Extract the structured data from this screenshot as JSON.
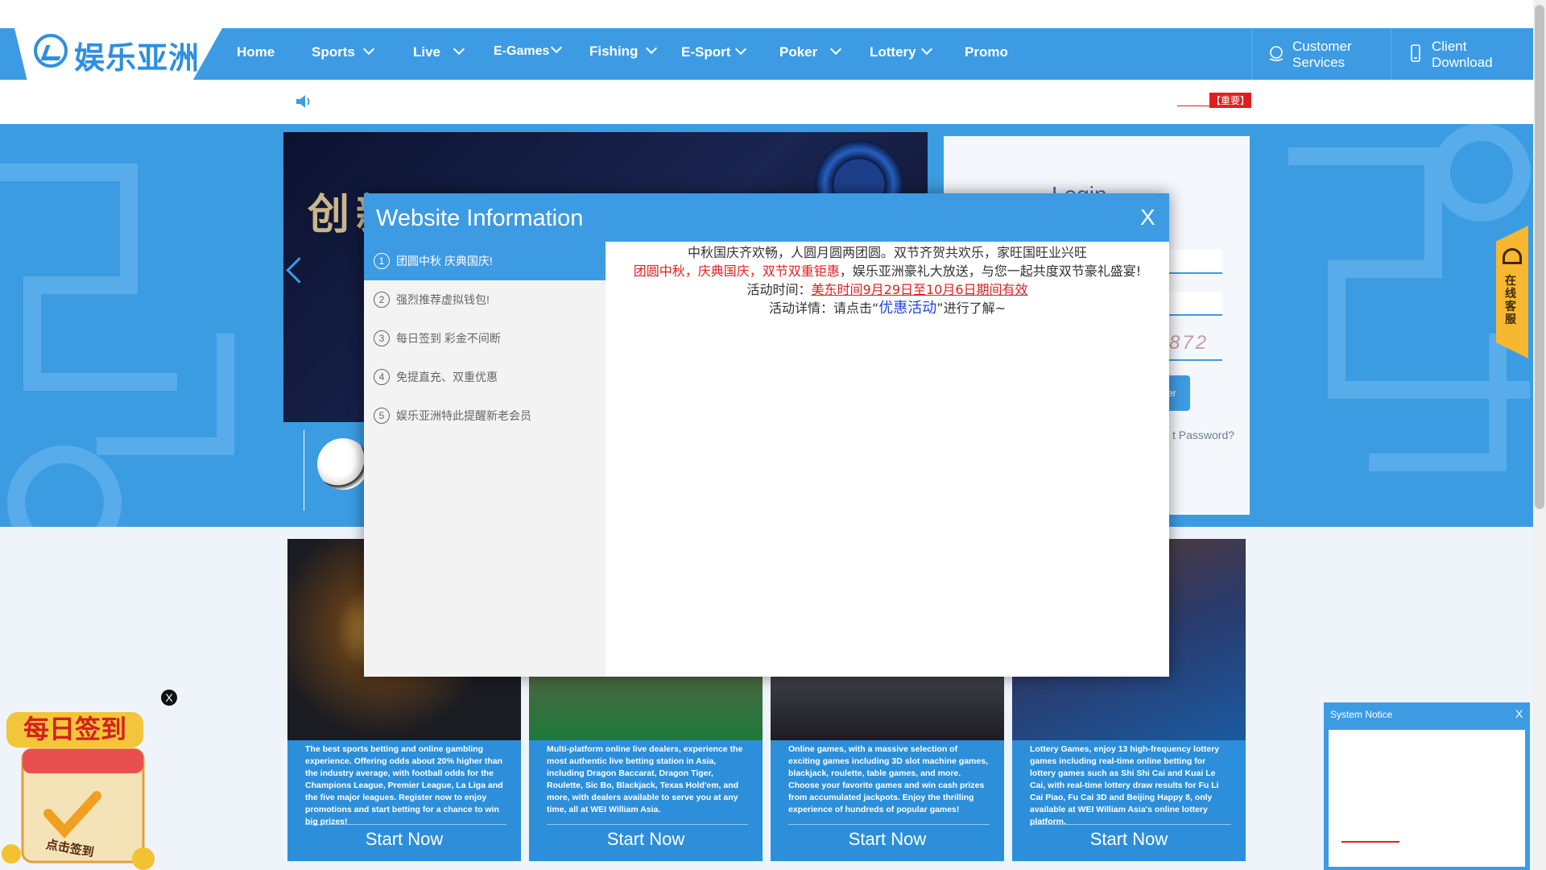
{
  "brand": {
    "logo_text": "娱乐亚洲"
  },
  "nav": {
    "items": [
      {
        "label": "Home",
        "chev": false
      },
      {
        "label": "Sports",
        "chev": true
      },
      {
        "label": "Live",
        "chev": true
      },
      {
        "label": "E-Games",
        "chev": true
      },
      {
        "label": "Fishing",
        "chev": true
      },
      {
        "label": "E-Sport",
        "chev": true
      },
      {
        "label": "Poker",
        "chev": true
      },
      {
        "label": "Lottery",
        "chev": true
      },
      {
        "label": "Promo",
        "chev": false
      }
    ],
    "customer_services": [
      "Customer",
      "Services"
    ],
    "client_download": [
      "Client",
      "Download"
    ]
  },
  "notice": {
    "marquee_tag": "【重要】"
  },
  "banner": {
    "headline": "创新"
  },
  "login": {
    "title": "Login",
    "captcha": "872",
    "button_fragment": "er",
    "forgot_fragment": "t Password?"
  },
  "side_tab": {
    "label": "在线客服"
  },
  "cards": [
    {
      "desc": "The best sports betting and online gambling experience. Offering odds about 20% higher than the industry average, with football odds for the Champions League, Premier League, La Liga and the five major leagues. Register now to enjoy promotions and start betting for a chance to win big prizes!",
      "button": "Start Now"
    },
    {
      "desc": "Multi-platform online live dealers, experience the most authentic live betting station in Asia, including Dragon Baccarat, Dragon Tiger, Roulette, Sic Bo, Blackjack, Texas Hold'em, and more, with dealers available to serve you at any time, all at WEI William Asia.",
      "button": "Start Now"
    },
    {
      "desc": "Online games, with a massive selection of exciting games including 3D slot machine games, blackjack, roulette, table games, and more. Choose your favorite games and win cash prizes from accumulated jackpots. Enjoy the thrilling experience of hundreds of popular games!",
      "button": "Start Now"
    },
    {
      "desc": "Lottery Games, enjoy 13 high-frequency lottery games including real-time online betting for lottery games such as Shi Shi Cai and Kuai Le Cai, with real-time lottery draw results for Fu Li Cai Piao, Fu Cai 3D and Beijing Happy 8, only available at WEI William Asia's online lottery platform.",
      "button": "Start Now"
    }
  ],
  "modal": {
    "title": "Website Information",
    "close": "X",
    "items": [
      {
        "num": "1",
        "label": "团圆中秋 庆典国庆!"
      },
      {
        "num": "2",
        "label": "强烈推荐虚拟钱包!"
      },
      {
        "num": "3",
        "label": "每日签到 彩金不间断"
      },
      {
        "num": "4",
        "label": "免提直充、双重优惠"
      },
      {
        "num": "5",
        "label": "娱乐亚洲特此提醒新老会员"
      }
    ],
    "body": {
      "line1": "中秋国庆齐欢畅，人圆月圆两团圆。双节齐贺共欢乐，家旺国旺业兴旺",
      "line2_red": "团圆中秋，庆典国庆，双节双重钜惠",
      "line2_rest": "，娱乐亚洲豪礼大放送，与您一起共度双节豪礼盛宴!",
      "time_label": "活动时间：",
      "time_value": "美东时间9月29日至10月6日期间有效",
      "detail_pre": "活动详情：请点击“",
      "detail_link": "优惠活动",
      "detail_post": "”进行了解~"
    }
  },
  "daily_checkin": {
    "title": "每日签到",
    "button": "点击签到",
    "close": "X"
  },
  "system_notice": {
    "title": "System Notice",
    "close": "X"
  }
}
